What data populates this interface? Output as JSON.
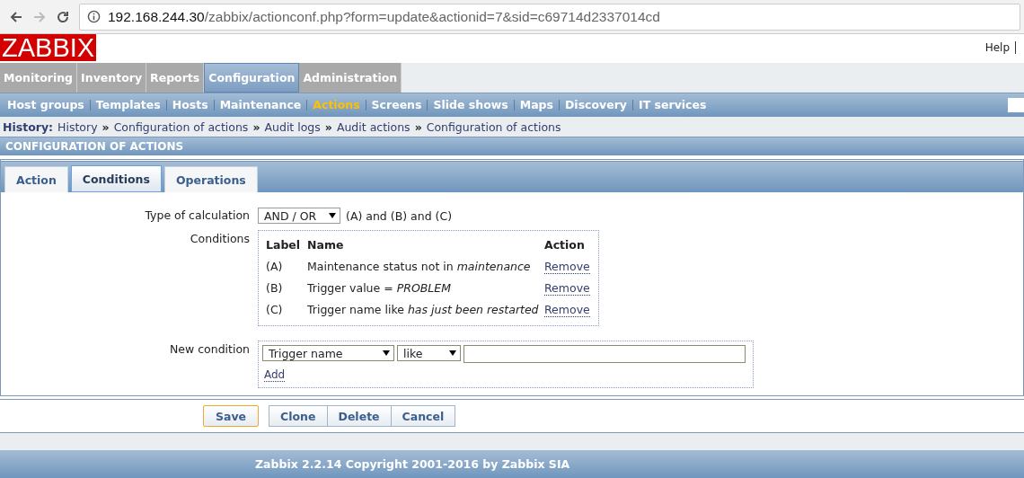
{
  "browser": {
    "url_host": "192.168.244.30",
    "url_path": "/zabbix/actionconf.php?form=update&actionid=7&sid=c69714d2337014cd"
  },
  "logo": "ZABBIX",
  "help": "Help",
  "main_menu": [
    {
      "label": "Monitoring",
      "selected": false
    },
    {
      "label": "Inventory",
      "selected": false
    },
    {
      "label": "Reports",
      "selected": false
    },
    {
      "label": "Configuration",
      "selected": true
    },
    {
      "label": "Administration",
      "selected": false
    }
  ],
  "sub_menu": [
    {
      "label": "Host groups",
      "selected": false
    },
    {
      "label": "Templates",
      "selected": false
    },
    {
      "label": "Hosts",
      "selected": false
    },
    {
      "label": "Maintenance",
      "selected": false
    },
    {
      "label": "Actions",
      "selected": true
    },
    {
      "label": "Screens",
      "selected": false
    },
    {
      "label": "Slide shows",
      "selected": false
    },
    {
      "label": "Maps",
      "selected": false
    },
    {
      "label": "Discovery",
      "selected": false
    },
    {
      "label": "IT services",
      "selected": false
    }
  ],
  "history": {
    "label": "History:",
    "separator": "»",
    "items": [
      "History",
      "Configuration of actions",
      "Audit logs",
      "Audit actions",
      "Configuration of actions"
    ]
  },
  "page_title": "CONFIGURATION OF ACTIONS",
  "tabs": [
    {
      "label": "Action",
      "selected": false
    },
    {
      "label": "Conditions",
      "selected": true
    },
    {
      "label": "Operations",
      "selected": false
    }
  ],
  "form": {
    "calc_label": "Type of calculation",
    "calc_value": "AND / OR",
    "calc_formula": "(A) and (B) and (C)",
    "conditions_label": "Conditions",
    "columns": [
      "Label",
      "Name",
      "Action"
    ],
    "conditions": [
      {
        "label": "(A)",
        "name": "Maintenance status not in *maintenance*",
        "action": "Remove"
      },
      {
        "label": "(B)",
        "name": "Trigger value = *PROBLEM*",
        "action": "Remove"
      },
      {
        "label": "(C)",
        "name": "Trigger name like *has just been restarted*",
        "action": "Remove"
      }
    ],
    "new_label": "New condition",
    "new_type": "Trigger name",
    "new_operator": "like",
    "add": "Add"
  },
  "buttons": [
    {
      "label": "Save",
      "kind": "primary"
    },
    {
      "label": "Clone",
      "kind": "group"
    },
    {
      "label": "Delete",
      "kind": "group"
    },
    {
      "label": "Cancel",
      "kind": "group"
    }
  ],
  "footer": "Zabbix 2.2.14 Copyright 2001-2016 by Zabbix SIA"
}
